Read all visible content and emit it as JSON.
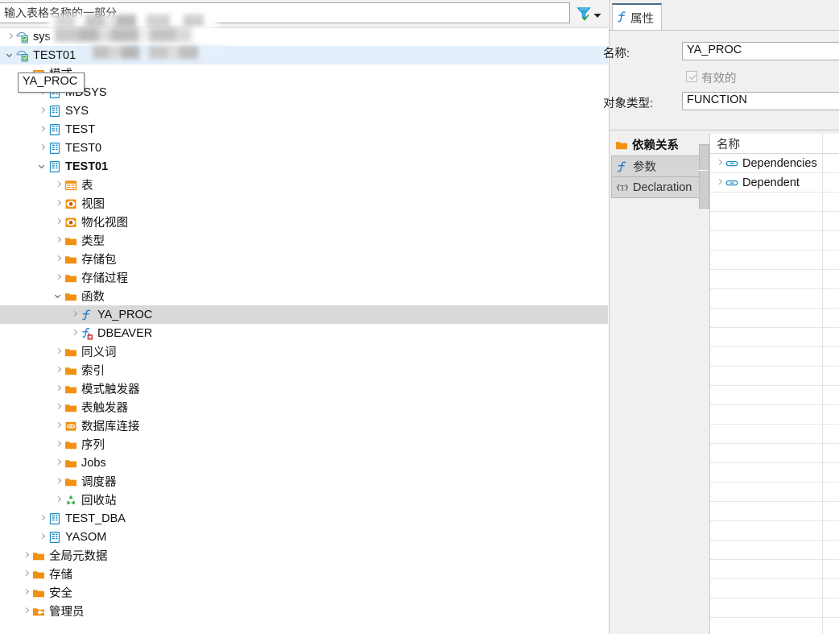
{
  "navigator": {
    "filter": {
      "placeholder": "输入表格名称的一部分",
      "value": "",
      "filter_icon": "funnel-check-icon",
      "dropdown_icon": "chevron-down-icon"
    },
    "tooltip": {
      "text": "YA_PROC"
    },
    "tree": [
      {
        "label": "sys",
        "indent": 0,
        "twist": "collapsed",
        "icon": "database-connection-icon",
        "selected": "none",
        "bold": false
      },
      {
        "label": "TEST01",
        "indent": 0,
        "twist": "expanded",
        "icon": "database-connection-icon",
        "selected": "blue",
        "bold": false
      },
      {
        "label": "模式",
        "indent": 1,
        "twist": "expanded",
        "icon": "schema-folder-icon",
        "selected": "none",
        "bold": false
      },
      {
        "label": "MDSYS",
        "indent": 2,
        "twist": "collapsed",
        "icon": "schema-icon",
        "selected": "none",
        "bold": false
      },
      {
        "label": "SYS",
        "indent": 2,
        "twist": "collapsed",
        "icon": "schema-icon",
        "selected": "none",
        "bold": false
      },
      {
        "label": "TEST",
        "indent": 2,
        "twist": "collapsed",
        "icon": "schema-icon",
        "selected": "none",
        "bold": false
      },
      {
        "label": "TEST0",
        "indent": 2,
        "twist": "collapsed",
        "icon": "schema-icon",
        "selected": "none",
        "bold": false
      },
      {
        "label": "TEST01",
        "indent": 2,
        "twist": "expanded",
        "icon": "schema-icon",
        "selected": "none",
        "bold": true
      },
      {
        "label": "表",
        "indent": 3,
        "twist": "collapsed",
        "icon": "table-icon",
        "selected": "none",
        "bold": false
      },
      {
        "label": "视图",
        "indent": 3,
        "twist": "collapsed",
        "icon": "view-eye-icon",
        "selected": "none",
        "bold": false
      },
      {
        "label": "物化视图",
        "indent": 3,
        "twist": "collapsed",
        "icon": "view-eye-icon",
        "selected": "none",
        "bold": false
      },
      {
        "label": "类型",
        "indent": 3,
        "twist": "collapsed",
        "icon": "folder-icon",
        "selected": "none",
        "bold": false
      },
      {
        "label": "存储包",
        "indent": 3,
        "twist": "collapsed",
        "icon": "folder-icon",
        "selected": "none",
        "bold": false
      },
      {
        "label": "存储过程",
        "indent": 3,
        "twist": "collapsed",
        "icon": "folder-icon",
        "selected": "none",
        "bold": false
      },
      {
        "label": "函数",
        "indent": 3,
        "twist": "expanded",
        "icon": "folder-icon",
        "selected": "none",
        "bold": false
      },
      {
        "label": "YA_PROC",
        "indent": 4,
        "twist": "collapsed",
        "icon": "function-icon",
        "selected": "gray",
        "bold": false
      },
      {
        "label": "DBEAVER",
        "indent": 4,
        "twist": "collapsed",
        "icon": "function-error-icon",
        "selected": "none",
        "bold": false
      },
      {
        "label": "同义词",
        "indent": 3,
        "twist": "collapsed",
        "icon": "folder-icon",
        "selected": "none",
        "bold": false
      },
      {
        "label": "索引",
        "indent": 3,
        "twist": "collapsed",
        "icon": "folder-icon",
        "selected": "none",
        "bold": false
      },
      {
        "label": "模式触发器",
        "indent": 3,
        "twist": "collapsed",
        "icon": "folder-icon",
        "selected": "none",
        "bold": false
      },
      {
        "label": "表触发器",
        "indent": 3,
        "twist": "collapsed",
        "icon": "folder-icon",
        "selected": "none",
        "bold": false
      },
      {
        "label": "数据库连接",
        "indent": 3,
        "twist": "collapsed",
        "icon": "db-link-icon",
        "selected": "none",
        "bold": false
      },
      {
        "label": "序列",
        "indent": 3,
        "twist": "collapsed",
        "icon": "folder-icon",
        "selected": "none",
        "bold": false
      },
      {
        "label": "Jobs",
        "indent": 3,
        "twist": "collapsed",
        "icon": "folder-icon",
        "selected": "none",
        "bold": false
      },
      {
        "label": "调度器",
        "indent": 3,
        "twist": "collapsed",
        "icon": "folder-icon",
        "selected": "none",
        "bold": false
      },
      {
        "label": "回收站",
        "indent": 3,
        "twist": "collapsed",
        "icon": "recycle-icon",
        "selected": "none",
        "bold": false
      },
      {
        "label": "TEST_DBA",
        "indent": 2,
        "twist": "collapsed",
        "icon": "schema-icon",
        "selected": "none",
        "bold": false
      },
      {
        "label": "YASOM",
        "indent": 2,
        "twist": "collapsed",
        "icon": "schema-icon",
        "selected": "none",
        "bold": false
      },
      {
        "label": "全局元数据",
        "indent": 1,
        "twist": "collapsed",
        "icon": "folder-icon",
        "selected": "none",
        "bold": false
      },
      {
        "label": "存储",
        "indent": 1,
        "twist": "collapsed",
        "icon": "folder-icon",
        "selected": "none",
        "bold": false
      },
      {
        "label": "安全",
        "indent": 1,
        "twist": "collapsed",
        "icon": "folder-icon",
        "selected": "none",
        "bold": false
      },
      {
        "label": "管理员",
        "indent": 1,
        "twist": "collapsed",
        "icon": "admin-folder-icon",
        "selected": "none",
        "bold": false
      }
    ]
  },
  "editor": {
    "tab": {
      "label": "属性",
      "icon": "function-icon"
    },
    "properties": {
      "name_label": "名称:",
      "name_value": "YA_PROC",
      "valid_label": "有效的",
      "valid_checked": true,
      "objtype_label": "对象类型:",
      "objtype_value": "FUNCTION"
    },
    "bottom_tabs": [
      {
        "label": "依赖关系",
        "icon": "folder-icon",
        "active": true
      },
      {
        "label": "参数",
        "icon": "function-icon",
        "active": false
      },
      {
        "label": "Declaration",
        "icon": "source-text-icon",
        "active": false
      }
    ],
    "dependency_table": {
      "column_header": "名称",
      "rows": [
        {
          "label": "Dependencies",
          "icon": "link-icon"
        },
        {
          "label": "Dependent",
          "icon": "link-icon"
        }
      ],
      "empty_row_count": 23
    }
  },
  "colors": {
    "selection_blue": "#e4effc",
    "selection_gray": "#d9d9d9",
    "folder_orange": "#f29111",
    "schema_blue": "#1e8bc3",
    "function_blue": "#2a7fc9",
    "recycle_green": "#2faa3d",
    "tab_accent": "#4a6e8a"
  }
}
